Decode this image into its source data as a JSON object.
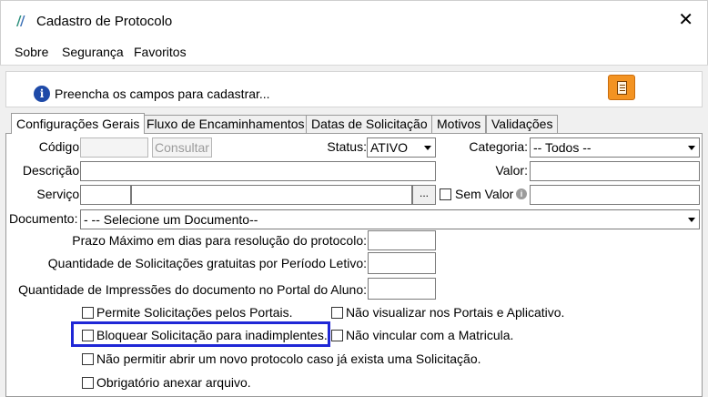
{
  "window": {
    "title": "Cadastro de Protocolo",
    "close_glyph": "✕",
    "logo_icon": "app-logo-icon"
  },
  "menu": [
    "Sobre",
    "Segurança",
    "Favoritos"
  ],
  "info": {
    "icon": "info-icon",
    "icon_glyph": "i",
    "message": "Preencha os campos para cadastrar..."
  },
  "tabs": [
    "Configurações Gerais",
    "Fluxo de Encaminhamentos",
    "Datas de Solicitação",
    "Motivos",
    "Validações"
  ],
  "active_tab": "Configurações Gerais",
  "form": {
    "codigo_label": "Código:",
    "codigo_value": "",
    "consultar_label": "Consultar",
    "status_label": "Status:",
    "status_value": "ATIVO",
    "categoria_label": "Categoria:",
    "categoria_value": "-- Todos --",
    "descricao_label": "Descrição:",
    "descricao_value": "",
    "valor_label": "Valor:",
    "valor_value": "",
    "servico_label": "Serviço:",
    "servico_code": "",
    "servico_name": "",
    "lookup_label": "...",
    "sem_valor_label": "Sem Valor",
    "sem_valor_checked": false,
    "sem_valor_value": "",
    "documento_label": "Documento:",
    "documento_value": "- -- Selecione um Documento--",
    "prazo_label": "Prazo Máximo em dias para resolução do protocolo:",
    "prazo_value": "",
    "gratuitas_label": "Quantidade de Solicitações gratuitas por Período Letivo:",
    "gratuitas_value": "",
    "impressoes_label": "Quantidade de Impressões do documento no Portal do Aluno:",
    "impressoes_value": ""
  },
  "checkboxes": {
    "permite_portais": {
      "label": "Permite Solicitações pelos Portais.",
      "checked": false
    },
    "nao_visualizar": {
      "label": "Não visualizar nos Portais e Aplicativo.",
      "checked": false
    },
    "bloquear_inadimplentes": {
      "label": "Bloquear Solicitação para inadimplentes.",
      "checked": false
    },
    "nao_vincular": {
      "label": "Não vincular com a Matricula.",
      "checked": false
    },
    "nao_permitir_novo": {
      "label": "Não permitir abrir um novo protocolo caso já exista uma Solicitação.",
      "checked": false
    },
    "obrigatorio_anexar": {
      "label": "Obrigatório anexar arquivo.",
      "checked": false
    }
  },
  "colors": {
    "highlight": "#1f27d6",
    "doc_button": "#f39322",
    "info_icon": "#1e4aa8"
  }
}
